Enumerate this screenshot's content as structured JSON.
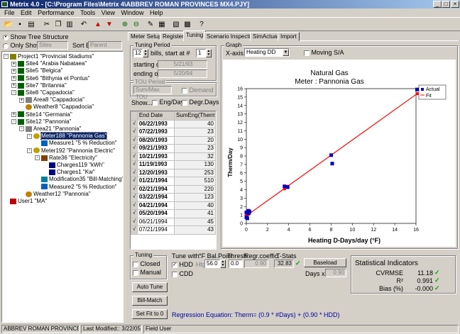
{
  "window": {
    "title": "Metrix 4.0 - [C:\\Program Files\\Metrix 4\\ABBREV ROMAN PROVINCES MX4.PJY]"
  },
  "menu": [
    "File",
    "Edit",
    "Performance",
    "Tools",
    "View",
    "Window",
    "Help"
  ],
  "toolbar_icons": [
    "open-icon",
    "save-icon",
    "print-icon",
    "cut-icon",
    "copy-icon",
    "paste-icon",
    "undo-icon",
    "up-arrow-icon",
    "down-arrow-icon",
    "tree-expand-icon",
    "tree-collapse-icon",
    "edit-icon",
    "report-icon",
    "chart-icon",
    "table-icon",
    "help-icon"
  ],
  "left": {
    "show_tree": "Show Tree Structure",
    "only_show": "Only Show...",
    "sites_placeholder": "Sites",
    "sort_by": "Sort By",
    "sort_value": "Parent",
    "tree": [
      {
        "label": "Project1 \"Provincial Stadiums\"",
        "level": 0,
        "pm": "-",
        "icon": "project-icon"
      },
      {
        "label": "Site4 \"Arabia Nabataea\"",
        "level": 1,
        "pm": "+",
        "icon": "site-icon"
      },
      {
        "label": "Site5 \"Belgica\"",
        "level": 1,
        "pm": "+",
        "icon": "site-icon"
      },
      {
        "label": "Site6 \"Bithynia et Pontus\"",
        "level": 1,
        "pm": "+",
        "icon": "site-icon"
      },
      {
        "label": "Site7 \"Britannia\"",
        "level": 1,
        "pm": "+",
        "icon": "site-icon"
      },
      {
        "label": "Site8 \"Cappadocia\"",
        "level": 1,
        "pm": "-",
        "icon": "site-icon"
      },
      {
        "label": "Area8 \"Cappadocia\"",
        "level": 2,
        "pm": "+",
        "icon": "area-icon"
      },
      {
        "label": "Weather8 \"Cappadocia\"",
        "level": 2,
        "pm": "",
        "icon": "weather-icon"
      },
      {
        "label": "Site14 \"Germania\"",
        "level": 1,
        "pm": "+",
        "icon": "site-icon"
      },
      {
        "label": "Site12 \"Pannonia\"",
        "level": 1,
        "pm": "-",
        "icon": "site-icon"
      },
      {
        "label": "Area21 \"Pannonia\"",
        "level": 2,
        "pm": "-",
        "icon": "area-icon"
      },
      {
        "label": "Meter188 \"Pannonia Gas\"",
        "level": 3,
        "pm": "-",
        "icon": "meter-icon",
        "selected": true
      },
      {
        "label": "Measure1 \"5 % Reduction\"",
        "level": 4,
        "pm": "",
        "icon": "measure-icon"
      },
      {
        "label": "Meter192 \"Pannonia Electric\"",
        "level": 3,
        "pm": "-",
        "icon": "meter-icon"
      },
      {
        "label": "Rate36 \"Electricity\"",
        "level": 4,
        "pm": "-",
        "icon": "rate-icon"
      },
      {
        "label": "Charges119 \"kWh\"",
        "level": 5,
        "pm": "",
        "icon": "charges-icon"
      },
      {
        "label": "Charges1 \"Kw\"",
        "level": 5,
        "pm": "",
        "icon": "charges-icon"
      },
      {
        "label": "Modification35 \"Bill-Matching\"",
        "level": 4,
        "pm": "",
        "icon": "modification-icon"
      },
      {
        "label": "Measure2 \"5 % Reduction\"",
        "level": 4,
        "pm": "",
        "icon": "measure-icon"
      },
      {
        "label": "Weather12 \"Pannonia\"",
        "level": 2,
        "pm": "",
        "icon": "weather-icon"
      },
      {
        "label": "User1 \"MA\"",
        "level": 0,
        "pm": "",
        "icon": "user-icon"
      }
    ]
  },
  "tabs": [
    "Meter Setup",
    "Register",
    "Tuning",
    "Scenario Inspection",
    "SimActual",
    "Import"
  ],
  "tuning_period": {
    "label": "Tuning Period",
    "bills": "12",
    "bills_text": "bills, start at #",
    "start_num": "1",
    "starting_on_label": "starting on",
    "starting_on": "5/21/93",
    "ending_on_label": "ending on",
    "ending_on": "5/20/94"
  },
  "tou": {
    "label": "TOU Period",
    "select": "Sum/Max TOU",
    "demand": "Demand"
  },
  "show": {
    "label": "Show...",
    "eng_day": "Eng/Day",
    "degr_days": "Degr.Days"
  },
  "table": {
    "headers": [
      "End Date",
      "SumEng(Therm"
    ],
    "rows": [
      {
        "date": "06/22/1993",
        "val": "40",
        "bold": true
      },
      {
        "date": "07/22/1993",
        "val": "23",
        "bold": true
      },
      {
        "date": "08/20/1993",
        "val": "20",
        "bold": true
      },
      {
        "date": "09/21/1993",
        "val": "23",
        "bold": true
      },
      {
        "date": "10/21/1993",
        "val": "32",
        "bold": true
      },
      {
        "date": "11/19/1993",
        "val": "130",
        "bold": true
      },
      {
        "date": "12/20/1993",
        "val": "253",
        "bold": true
      },
      {
        "date": "01/21/1994",
        "val": "510",
        "bold": true
      },
      {
        "date": "02/21/1994",
        "val": "220",
        "bold": true
      },
      {
        "date": "03/22/1994",
        "val": "123",
        "bold": true
      },
      {
        "date": "04/21/1994",
        "val": "40",
        "bold": true
      },
      {
        "date": "05/20/1994",
        "val": "41",
        "bold": true
      },
      {
        "date": "06/21/1994",
        "val": "45",
        "bold": false
      },
      {
        "date": "07/21/1994",
        "val": "43",
        "bold": false
      }
    ]
  },
  "graph": {
    "label": "Graph",
    "xaxis_label": "X-axis:",
    "xaxis_value": "Heating DD",
    "moving_sa": "Moving S/A"
  },
  "chart_data": {
    "type": "scatter",
    "title": "Natural Gas",
    "subtitle": "Meter : Pannonia Gas",
    "xlabel": "Heating D-Days/day (°F)",
    "ylabel": "Therm/Day",
    "xlim": [
      0,
      16
    ],
    "ylim": [
      0,
      16
    ],
    "xticks": [
      0,
      2,
      4,
      6,
      8,
      10,
      12,
      14,
      16
    ],
    "yticks": [
      0,
      1,
      2,
      3,
      4,
      5,
      6,
      7,
      8,
      9,
      10,
      11,
      12,
      13,
      14,
      15,
      16
    ],
    "legend": [
      "Actual",
      "Fit"
    ],
    "legend_position": "top-right",
    "actual": [
      [
        0,
        0.7
      ],
      [
        0,
        1.3
      ],
      [
        0.1,
        0.6
      ],
      [
        0.1,
        1.3
      ],
      [
        0.2,
        1.2
      ],
      [
        0.3,
        1.4
      ],
      [
        0.2,
        1.5
      ],
      [
        3.6,
        4.4
      ],
      [
        3.9,
        4.3
      ],
      [
        8.0,
        8.1
      ],
      [
        8.1,
        7.1
      ],
      [
        16.1,
        15.9
      ]
    ],
    "fit": [
      [
        0,
        0.9
      ],
      [
        0.1,
        1.0
      ],
      [
        0.2,
        1.1
      ],
      [
        0.3,
        1.2
      ],
      [
        3.6,
        4.1
      ],
      [
        3.9,
        4.4
      ],
      [
        8.0,
        8.1
      ],
      [
        16.1,
        15.4
      ]
    ],
    "fit_line": [
      [
        0,
        0.9
      ],
      [
        16,
        15.3
      ]
    ],
    "colors": {
      "actual": "#0000c0",
      "fit": "#ff0000"
    }
  },
  "tuning": {
    "label": "Tuning",
    "closed": "Closed",
    "manual": "Manual",
    "tune_with": "Tune with:",
    "fbal": "°F Bal.Point",
    "thresh": "Thresh",
    "regr": "Regr.coeffic.",
    "tstats": "T-Stats",
    "hdd": "HDD",
    "cdd": "CDD",
    "htg": "Htg",
    "bal_val": "56.0",
    "thresh_val": "0.0",
    "regr_val": "0.90",
    "tstat_val": "32.83",
    "baseload": "Baseload",
    "days_x": "Days x",
    "days_val": "0.90"
  },
  "stats": {
    "label": "Statistical Indicators",
    "cvrmse_label": "CVRMSE",
    "cvrmse": "11.18",
    "r2_label": "R²",
    "r2": "0.991",
    "bias_label": "Bias (%)",
    "bias": "-0.000"
  },
  "buttons": {
    "auto_tune": "Auto Tune",
    "bill_match": "Bill-Match",
    "set_fit": "Set Fit to 0"
  },
  "regression": "Regression Equation: Therm= (0.9 * #Days) + (0.90 * HDD)",
  "status": {
    "project": "ABBREV ROMAN PROVINCES MX",
    "modified": "Last Modified:: 3/22/05",
    "user": "Field User"
  }
}
